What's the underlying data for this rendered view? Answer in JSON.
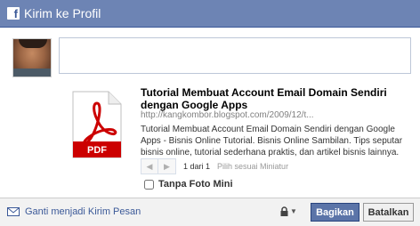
{
  "dialog": {
    "title": "Kirim ke Profil",
    "icon": "facebook-f-icon"
  },
  "composer": {
    "message_value": "",
    "message_placeholder": ""
  },
  "link_preview": {
    "thumbnail_icon": "pdf-document-icon",
    "thumbnail_label": "PDF",
    "title": "Tutorial Membuat Account Email Domain Sendiri dengan Google Apps",
    "url": "http://kangkombor.blogspot.com/2009/12/t...",
    "description": "Tutorial Membuat Account Email Domain Sendiri dengan Google Apps - Bisnis Online Tutorial. Bisnis Online Sambilan. Tips seputar bisnis online, tutorial sederhana praktis, dan artikel bisnis lainnya.",
    "pager": {
      "prev_icon": "arrow-left-icon",
      "next_icon": "arrow-right-icon",
      "count": "1 dari 1",
      "hint": "Pilih sesuai Miniatur"
    },
    "no_thumbnail_label": "Tanpa Foto Mini",
    "no_thumbnail_checked": false
  },
  "footer": {
    "switch_label": "Ganti menjadi Kirim Pesan",
    "switch_icon": "envelope-icon",
    "privacy_icon": "lock-icon",
    "share_label": "Bagikan",
    "cancel_label": "Batalkan"
  },
  "colors": {
    "header_bg": "#6d84b4",
    "link_blue": "#3b5998",
    "pdf_red": "#cc0000"
  }
}
